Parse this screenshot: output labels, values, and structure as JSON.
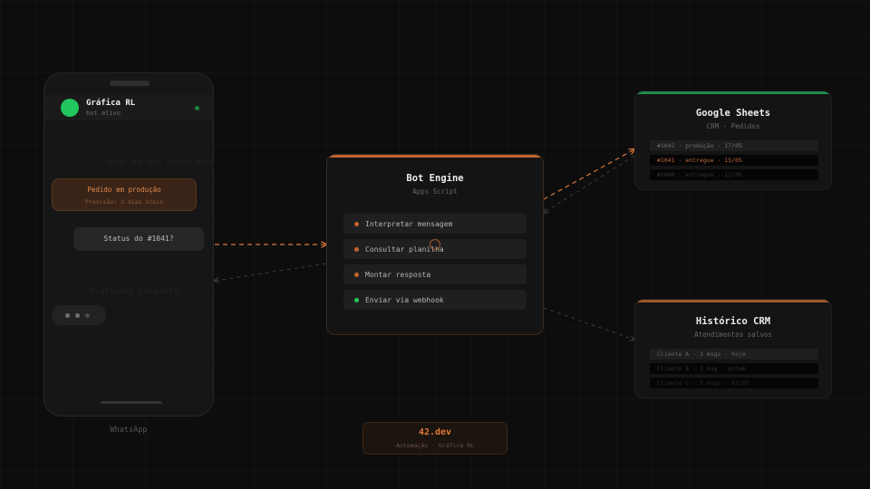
{
  "phone": {
    "contact_name": "Gráfica RL",
    "contact_status": "bot ativo",
    "ghost_top": "Olá! Em que posso ajudar?",
    "bubble_orange_title": "Pedido em produção",
    "bubble_orange_sub": "Previsão: 2 dias úteis",
    "bubble_grey": "Status do #1041?",
    "ghost_bottom": "Digitando resposta...",
    "caption": "WhatsApp"
  },
  "engine": {
    "title": "Bot Engine",
    "subtitle": "Apps Script",
    "steps": [
      {
        "label": "Interpretar mensagem",
        "dot": "#c0642f"
      },
      {
        "label": "Consultar planilha",
        "dot": "#c0642f"
      },
      {
        "label": "Montar resposta",
        "dot": "#c0642f"
      },
      {
        "label": "Enviar via webhook",
        "dot": "#22c55e"
      }
    ]
  },
  "sheets": {
    "title": "Google Sheets",
    "subtitle": "CRM · Pedidos",
    "accent": "#1f8a4c",
    "rows": [
      {
        "text": "#1042 · produção · 17/05"
      },
      {
        "text": "#1041 · entregue · 15/05"
      },
      {
        "text": "#1040 · entregue · 12/05"
      }
    ]
  },
  "history": {
    "title": "Histórico CRM",
    "subtitle": "Atendimentos salvos",
    "accent": "#a0562a",
    "rows": [
      {
        "text": "Cliente A · 3 msgs · hoje"
      },
      {
        "text": "Cliente B · 1 msg · ontem"
      },
      {
        "text": "Cliente C · 5 msgs · 02/05"
      }
    ]
  },
  "brand": {
    "name": "42.dev",
    "subtitle": "Automação · Gráfica RL"
  }
}
